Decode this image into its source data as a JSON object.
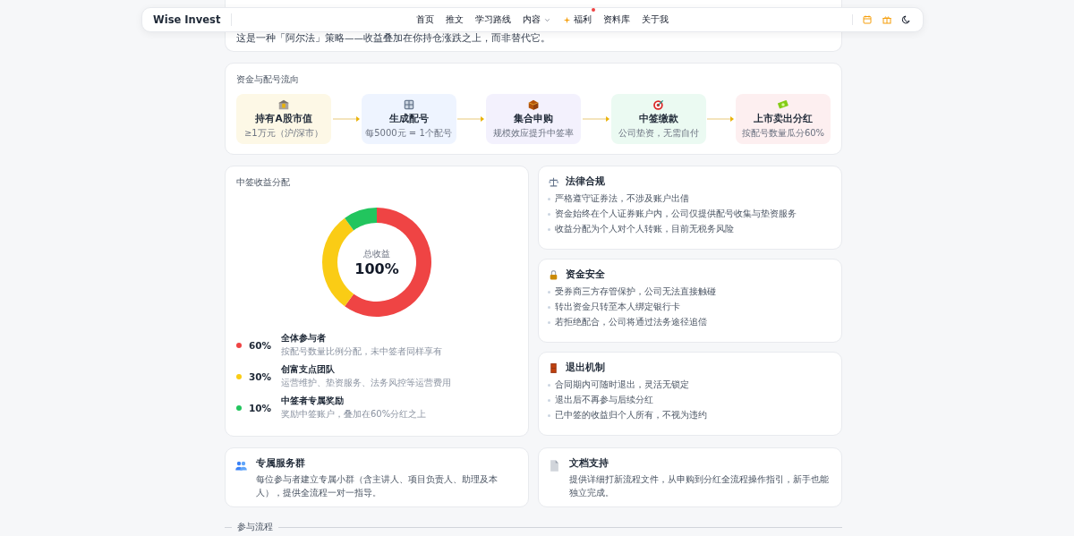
{
  "nav": {
    "brand": "Wise Invest",
    "items": [
      {
        "label": "首页",
        "kind": "link",
        "badge": false
      },
      {
        "label": "推文",
        "kind": "link",
        "badge": false
      },
      {
        "label": "学习路线",
        "kind": "link",
        "badge": false
      },
      {
        "label": "内容",
        "kind": "dropdown",
        "badge": false
      },
      {
        "label": "福利",
        "kind": "spark",
        "badge": true
      },
      {
        "label": "资料库",
        "kind": "link",
        "badge": false
      },
      {
        "label": "关于我",
        "kind": "link",
        "badge": false
      }
    ]
  },
  "intro": {
    "text": "这是一种「阿尔法」策略——收益叠加在你持仓涨跌之上，而非替代它。"
  },
  "flow": {
    "title": "资金与配号流向",
    "steps": [
      {
        "kind": "bank",
        "title": "持有A股市值",
        "sub": "≥1万元（沪/深市）",
        "color": "#fdf8e6"
      },
      {
        "kind": "numbers",
        "title": "生成配号",
        "sub": "每5000元 = 1个配号",
        "color": "#eef4ff"
      },
      {
        "kind": "box",
        "title": "集合申购",
        "sub": "规模效应提升中签率",
        "color": "#f3f1fd"
      },
      {
        "kind": "target",
        "title": "中签缴款",
        "sub": "公司垫资，无需自付",
        "color": "#ebfaf2"
      },
      {
        "kind": "money",
        "title": "上市卖出分红",
        "sub": "按配号数量瓜分60%",
        "color": "#fdeff0"
      }
    ]
  },
  "distribution": {
    "center_label": "总收益",
    "center_value": "100%",
    "chart_data": {
      "type": "donut",
      "title": "中签收益分配",
      "categories": [
        "全体参与者",
        "创富支点团队",
        "中签者专属奖励"
      ],
      "series": [
        {
          "values": [
            60,
            30,
            10
          ]
        }
      ]
    },
    "legend": [
      {
        "percent": "60%",
        "desc": "按配号数量比例分配，未中签者同样享有",
        "color": "#ef4444"
      },
      {
        "percent": "30%",
        "desc": "运营维护、垫资服务、法务风控等运营费用",
        "color": "#facc15"
      },
      {
        "percent": "10%",
        "desc": "奖励中签账户，叠加在60%分红之上",
        "color": "#22c55e"
      }
    ]
  },
  "rules": [
    {
      "kind": "scale",
      "title": "法律合规",
      "points": [
        "严格遵守证券法，不涉及账户出借",
        "资金始终在个人证券账户内，公司仅提供配号收集与垫资服务",
        "收益分配为个人对个人转账，目前无税务风险"
      ]
    },
    {
      "kind": "lock",
      "title": "资金安全",
      "points": [
        "受券商三方存管保护，公司无法直接触碰",
        "转出资金只转至本人绑定银行卡",
        "若拒绝配合，公司将通过法务途径追偿"
      ]
    },
    {
      "kind": "door",
      "title": "退出机制",
      "points": [
        "合同期内可随时退出，灵活无锁定",
        "退出后不再参与后续分红",
        "已中签的收益归个人所有，不视为违约"
      ]
    }
  ],
  "services": [
    {
      "kind": "people",
      "title": "专属服务群",
      "text": "每位参与者建立专属小群（含主讲人、项目负责人、助理及本人），提供全流程一对一指导。"
    },
    {
      "kind": "document",
      "title": "文档支持",
      "text": "提供详细打新流程文件，从申购到分红全流程操作指引，新手也能独立完成。"
    }
  ],
  "next_section": {
    "title": "参与流程"
  }
}
